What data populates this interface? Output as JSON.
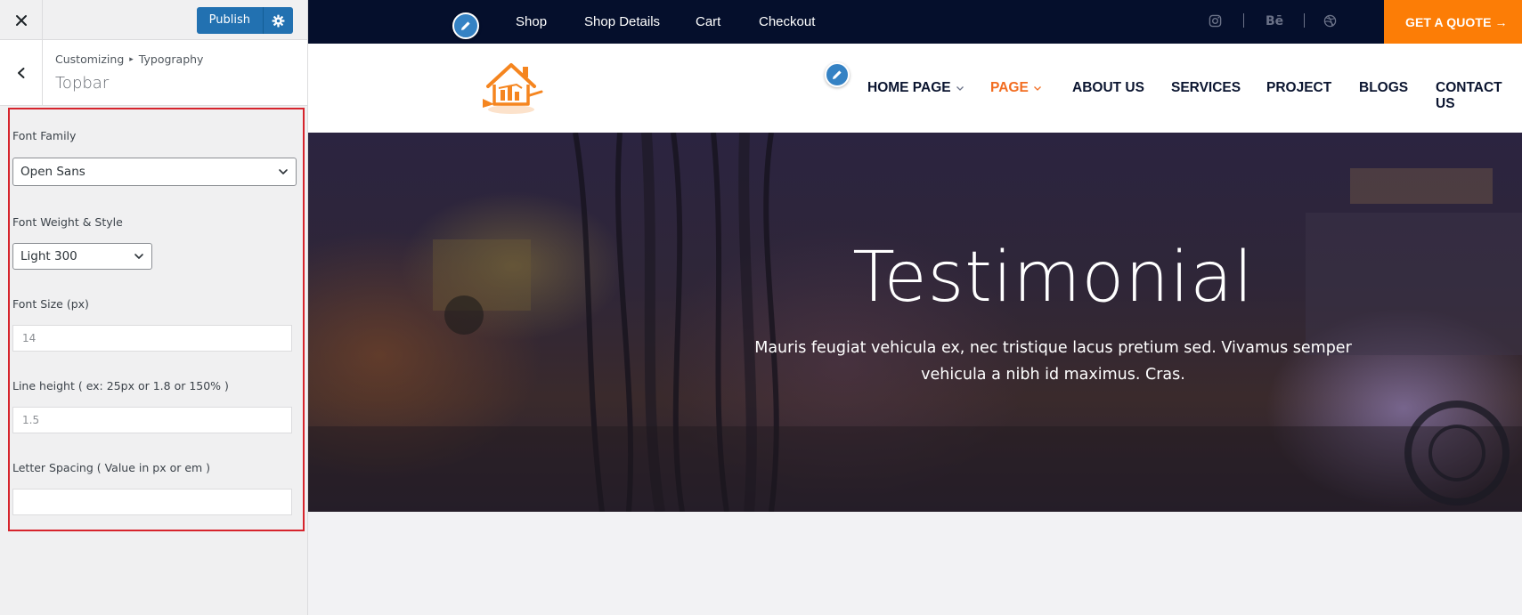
{
  "sidebar": {
    "publish_label": "Publish",
    "breadcrumb": {
      "parent": "Customizing",
      "separator": "▸",
      "current": "Typography"
    },
    "section_title": "Topbar",
    "controls": {
      "font_family": {
        "label": "Font Family",
        "value": "Open Sans"
      },
      "font_weight": {
        "label": "Font Weight & Style",
        "value": "Light 300"
      },
      "font_size": {
        "label": "Font Size (px)",
        "value": "14"
      },
      "line_height": {
        "label": "Line height ( ex: 25px or 1.8 or 150% )",
        "value": "1.5"
      },
      "letter_spacing": {
        "label": "Letter Spacing ( Value in px or em )",
        "value": ""
      }
    },
    "highlight_color": "#d6242c",
    "accent_color": "#2271b1"
  },
  "preview": {
    "topbar": {
      "links": [
        "Shop",
        "Shop Details",
        "Cart",
        "Checkout"
      ],
      "social": {
        "behance": "Bē"
      },
      "quote_label": "GET A QUOTE →",
      "background": "#050f2c",
      "quote_color": "#fc7d06"
    },
    "nav": {
      "items": [
        "HOME PAGE",
        "PAGE",
        "ABOUT US",
        "SERVICES",
        "PROJECT",
        "BLOGS",
        "CONTACT US"
      ],
      "active_color": "#f26d21"
    },
    "hero": {
      "title": "Testimonial",
      "text_line1": "Mauris feugiat vehicula ex, nec tristique lacus pretium sed. Vivamus semper",
      "text_line2": "vehicula a nibh id maximus. Cras."
    }
  }
}
